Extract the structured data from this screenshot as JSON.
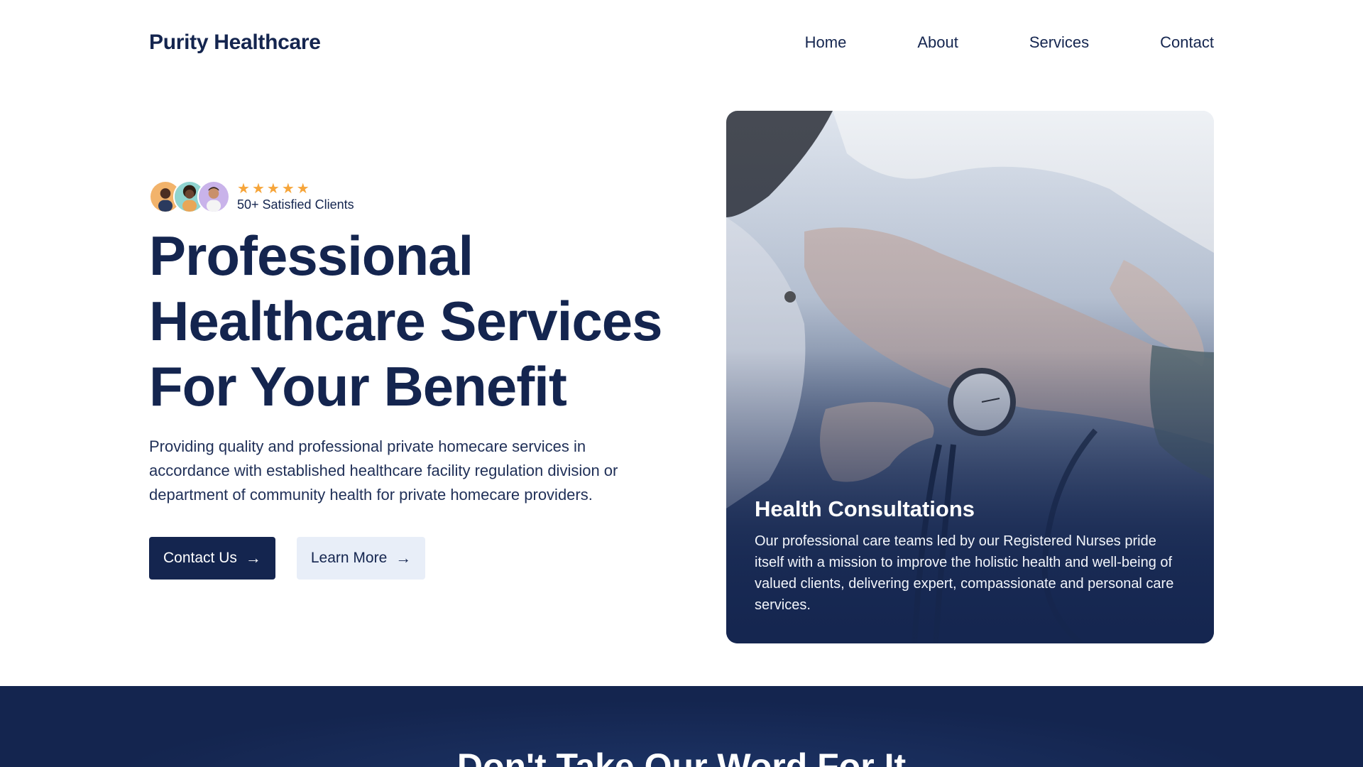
{
  "brand": "Purity Healthcare",
  "nav": {
    "items": [
      "Home",
      "About",
      "Services",
      "Contact"
    ]
  },
  "hero": {
    "social_proof": {
      "rating_stars": 5,
      "text": "50+ Satisfied Clients"
    },
    "headline_lines": [
      "Professional",
      "Healthcare Services",
      "For Your Benefit"
    ],
    "description": "Providing quality and professional private homecare services in accordance with established healthcare facility regulation division or department of community health for private homecare providers.",
    "buttons": {
      "primary_label": "Contact Us",
      "secondary_label": "Learn More"
    }
  },
  "card": {
    "title": "Health Consultations",
    "body": "Our professional care teams led by our Registered Nurses pride itself with a mission to improve the holistic health and well-being of valued clients, delivering expert, compassionate and personal care services."
  },
  "testimonials": {
    "title": "Don't Take Our Word For It"
  },
  "colors": {
    "primary": "#14254f",
    "star": "#f6a53a",
    "secondary_button_bg": "#e8eef8"
  }
}
